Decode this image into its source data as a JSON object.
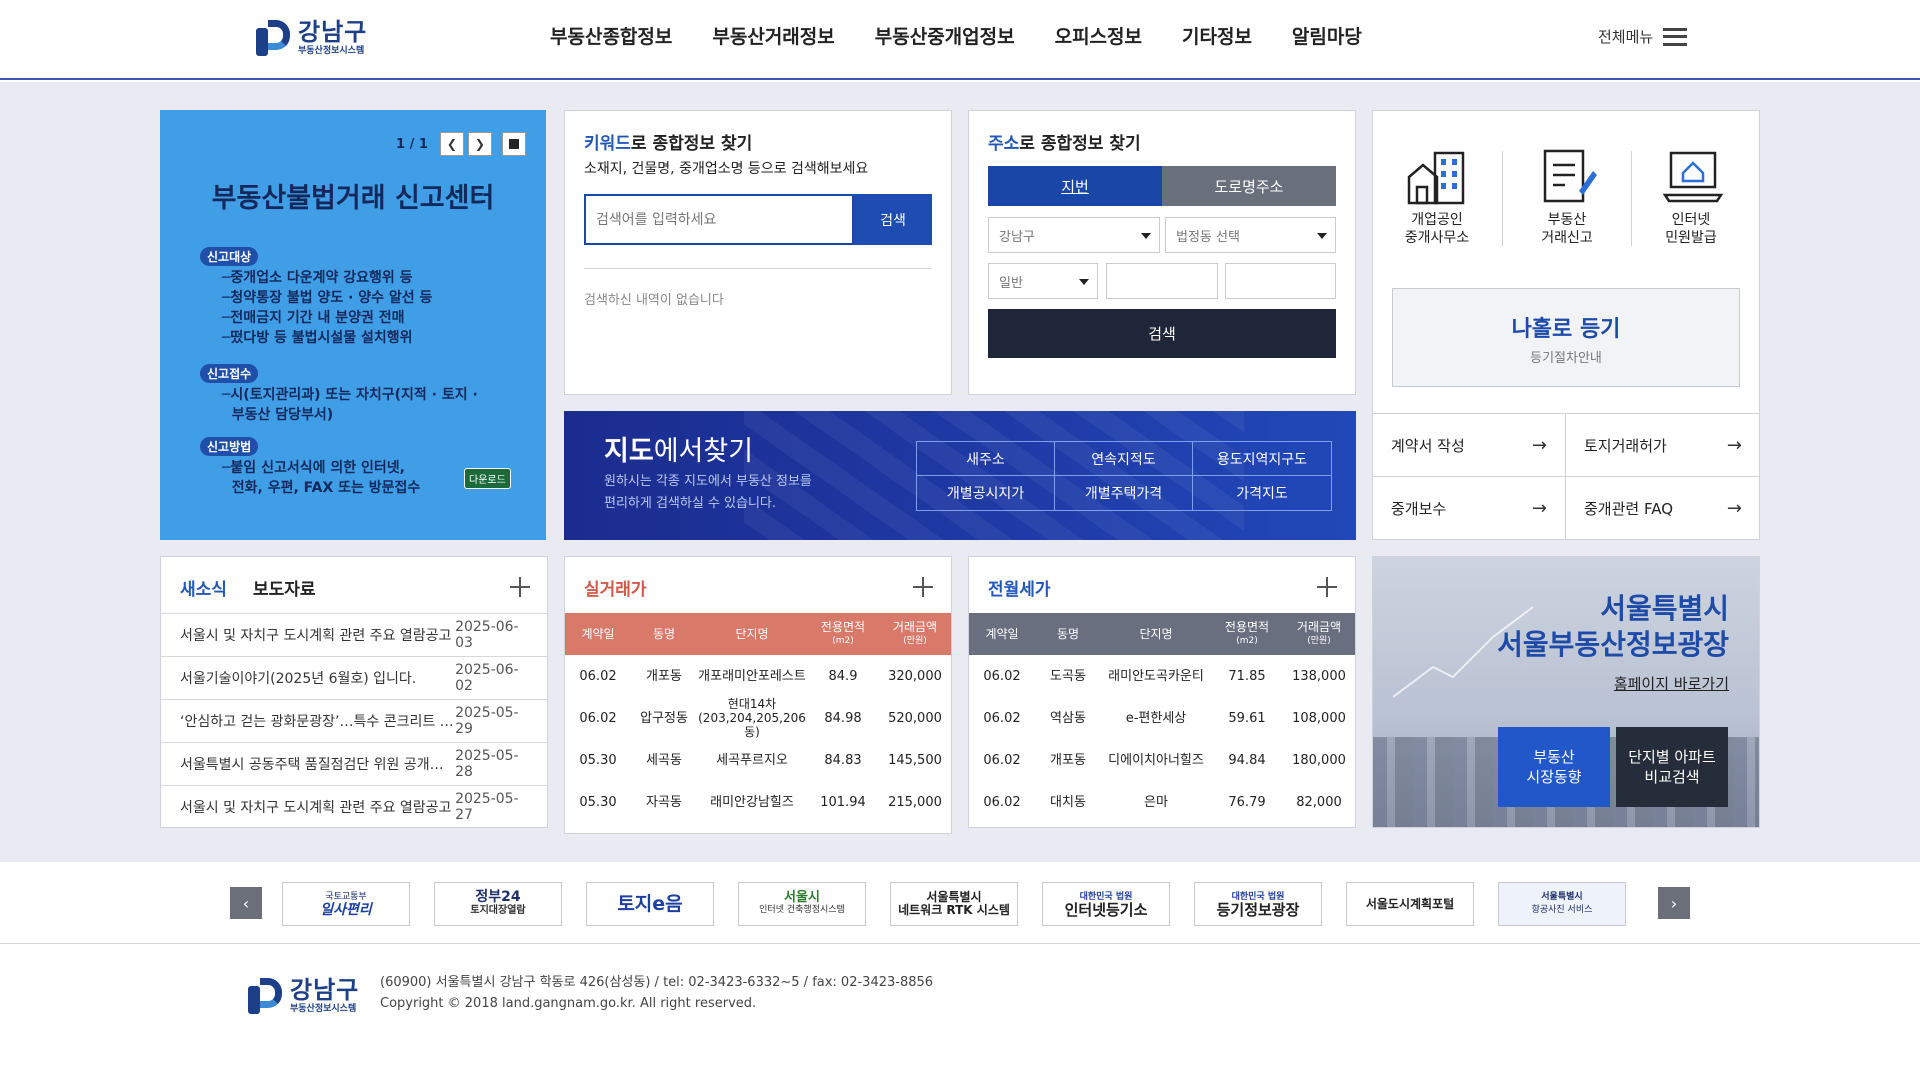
{
  "header": {
    "logo_title": "강남구",
    "logo_sub": "부동산정보시스템",
    "nav": [
      "부동산종합정보",
      "부동산거래정보",
      "부동산중개업정보",
      "오피스정보",
      "기타정보",
      "알림마당"
    ],
    "all_menu": "전체메뉴"
  },
  "banner": {
    "pager": "1 / 1",
    "title": "부동산불법거래 신고센터",
    "sections": [
      {
        "tag": "신고대상",
        "lines": [
          "─중개업소 다운계약 강요행위 등",
          "─청약통장 불법 양도 · 양수 알선 등",
          "─전매금지 기간 내 분양권 전매",
          "─떴다방 등 불법시설물 설치행위"
        ]
      },
      {
        "tag": "신고접수",
        "lines": [
          "─시(토지관리과) 또는 자치구(지적 · 토지 ·",
          "  부동산 담당부서)"
        ]
      },
      {
        "tag": "신고방법",
        "lines": [
          "─붙임 신고서식에 의한 인터넷,",
          "  전화, 우편, FAX 또는 방문접수"
        ]
      }
    ],
    "download": "다운로드"
  },
  "keyword": {
    "title_em": "키워드",
    "title_rest": "로 종합정보 찾기",
    "subtitle": "소재지, 건물명, 중개업소명 등으로 검색해보세요",
    "placeholder": "검색어를 입력하세요",
    "button": "검색",
    "empty": "검색하신 내역이 없습니다"
  },
  "address": {
    "title_em": "주소",
    "title_rest": "로 종합정보 찾기",
    "tab_active": "지번",
    "tab_inactive": "도로명주소",
    "select_gu": "강남구",
    "select_dong": "법정동 선택",
    "select_type": "일반",
    "button": "검색"
  },
  "quick": {
    "items": [
      {
        "label1": "개업공인",
        "label2": "중개사무소",
        "icon": "building-icon"
      },
      {
        "label1": "부동산",
        "label2": "거래신고",
        "icon": "document-pen-icon"
      },
      {
        "label1": "인터넷",
        "label2": "민원발급",
        "icon": "laptop-home-icon"
      }
    ],
    "self_reg_title": "나홀로 등기",
    "self_reg_sub": "등기절차안내",
    "links": [
      "계약서 작성",
      "토지거래허가",
      "중개보수",
      "중개관련 FAQ"
    ]
  },
  "map": {
    "title_bold": "지도",
    "title_rest": "에서찾기",
    "desc1": "원하시는 각종 지도에서 부동산 정보를",
    "desc2": "편리하게 검색하실 수 있습니다.",
    "items": [
      "새주소",
      "연속지적도",
      "용도지역지구도",
      "개별공시지가",
      "개별주택가격",
      "가격지도"
    ]
  },
  "news": {
    "tab_active": "새소식",
    "tab_inactive": "보도자료",
    "rows": [
      {
        "title": "서울시 및 자치구 도시계획 관련 주요 열람공고",
        "date": "2025-06-03"
      },
      {
        "title": "서울기술이야기(2025년 6월호) 입니다.",
        "date": "2025-06-02"
      },
      {
        "title": "‘안심하고 걷는 광화문광장’…특수 콘크리트 볼라드",
        "date": "2025-05-29"
      },
      {
        "title": "서울특별시 공동주택 품질점검단 위원 공개모집",
        "date": "2025-05-28"
      },
      {
        "title": "서울시 및 자치구 도시계획 관련 주요 열람공고",
        "date": "2025-05-27"
      }
    ]
  },
  "trade": {
    "title": "실거래가",
    "headers": [
      "계약일",
      "동명",
      "단지명",
      "전용면적",
      "거래금액"
    ],
    "units": [
      "",
      "",
      "",
      "(m2)",
      "(만원)"
    ],
    "rows": [
      [
        "06.02",
        "개포동",
        "개포래미안포레스트",
        "84.9",
        "320,000"
      ],
      [
        "06.02",
        "압구정동",
        "현대14차(203,204,205,206동)",
        "84.98",
        "520,000"
      ],
      [
        "05.30",
        "세곡동",
        "세곡푸르지오",
        "84.83",
        "145,500"
      ],
      [
        "05.30",
        "자곡동",
        "래미안강남힐즈",
        "101.94",
        "215,000"
      ]
    ],
    "color": "#d9796a"
  },
  "rent": {
    "title": "전월세가",
    "headers": [
      "계약일",
      "동명",
      "단지명",
      "전용면적",
      "거래금액"
    ],
    "units": [
      "",
      "",
      "",
      "(m2)",
      "(만원)"
    ],
    "rows": [
      [
        "06.02",
        "도곡동",
        "래미안도곡카운티",
        "71.85",
        "138,000"
      ],
      [
        "06.02",
        "역삼동",
        "e-편한세상",
        "59.61",
        "108,000"
      ],
      [
        "06.02",
        "개포동",
        "디에이치아너힐즈",
        "94.84",
        "180,000"
      ],
      [
        "06.02",
        "대치동",
        "은마",
        "76.79",
        "82,000"
      ]
    ],
    "color": "#6a6f80"
  },
  "seoul": {
    "line1": "서울특별시",
    "line2": "서울부동산정보광장",
    "link": "홈페이지 바로가기",
    "btn1_a": "부동산",
    "btn1_b": "시장동향",
    "btn2_a": "단지별 아파트",
    "btn2_b": "비교검색"
  },
  "links": [
    {
      "l1": "국토교통부",
      "l2": "일사편리"
    },
    {
      "l1": "정부24",
      "l2": "토지대장열람"
    },
    {
      "l1": "",
      "l2": "토지e음"
    },
    {
      "l1": "서울시",
      "l2": "인터넷 건축행정시스템"
    },
    {
      "l1": "서울특별시",
      "l2": "네트워크 RTK 시스템"
    },
    {
      "l1": "대한민국 법원",
      "l2": "인터넷등기소"
    },
    {
      "l1": "대한민국 법원",
      "l2": "등기정보광장"
    },
    {
      "l1": "",
      "l2": "서울도시계획포털"
    },
    {
      "l1": "서울특별시",
      "l2": "항공사진 서비스"
    }
  ],
  "footer": {
    "address": "(60900) 서울특별시 강남구 학동로 426(삼성동) / tel: 02-3423-6332~5 / fax: 02-3423-8856",
    "copyright": "Copyright © 2018 land.gangnam.go.kr. All right reserved."
  }
}
